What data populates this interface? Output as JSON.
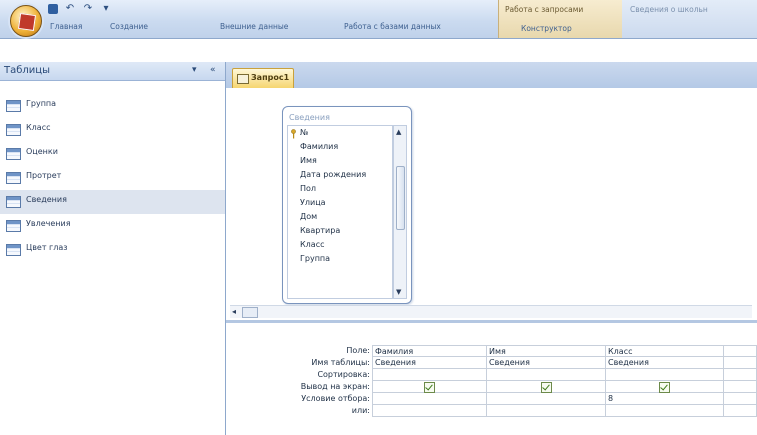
{
  "ribbon": {
    "tabs": [
      "Главная",
      "Создание",
      "Внешние данные",
      "Работа с базами данных"
    ],
    "context_group_title": "Работа с запросами",
    "context_tab": "Конструктор",
    "title_fragment": "Сведения о школьн"
  },
  "nav": {
    "title": "Таблицы",
    "dropdown_glyph": "▾",
    "collapse_glyph": "«",
    "items": [
      {
        "label": "Группа"
      },
      {
        "label": "Класс"
      },
      {
        "label": "Оценки"
      },
      {
        "label": "Протрет"
      },
      {
        "label": "Сведения",
        "selected": true
      },
      {
        "label": "Увлечения"
      },
      {
        "label": "Цвет глаз"
      }
    ]
  },
  "document": {
    "tab_label": "Запрос1"
  },
  "field_list": {
    "title": "Сведения",
    "fields": [
      "№",
      "Фамилия",
      "Имя",
      "Дата рождения",
      "Пол",
      "Улица",
      "Дом",
      "Квартира",
      "Класс",
      "Группа"
    ]
  },
  "grid": {
    "row_labels": [
      "Поле:",
      "Имя таблицы:",
      "Сортировка:",
      "Вывод на экран:",
      "Условие отбора:",
      "или:"
    ],
    "columns": [
      {
        "field": "Фамилия",
        "table": "Сведения",
        "show": true,
        "criteria": ""
      },
      {
        "field": "Имя",
        "table": "Сведения",
        "show": true,
        "criteria": ""
      },
      {
        "field": "Класс",
        "table": "Сведения",
        "show": true,
        "criteria": "8"
      }
    ]
  }
}
